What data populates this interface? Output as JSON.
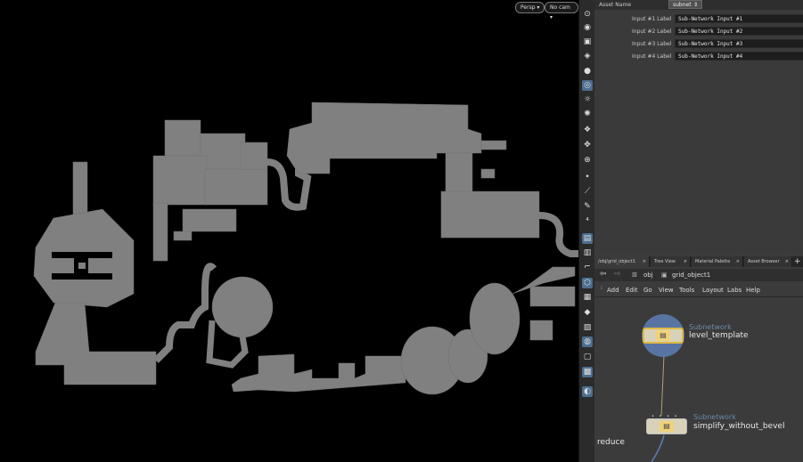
{
  "viewport": {
    "persp_label": "Persp",
    "cam_label": "No cam",
    "colors": {
      "shape": "#808080",
      "background": "#000000"
    }
  },
  "shelf": {
    "icons": [
      "view-icon",
      "eye-icon",
      "lock-icon",
      "camera-icon",
      "sphere-icon",
      "select-icon",
      "light-icon",
      "light-2-icon",
      "group-icon",
      "transform-icon",
      "handle-icon",
      "snap-icon",
      "dot-icon",
      "brush-icon",
      "pen-icon",
      "number-icon",
      "display-icon",
      "display-2-icon",
      "grid-icon",
      "wire-icon",
      "shading-icon",
      "diamond-icon",
      "box-icon",
      "paint-icon",
      "save-icon",
      "image-icon",
      "marker-icon"
    ]
  },
  "params": {
    "asset_name_label": "Asset Name",
    "asset_name_value": "subnet",
    "rows": [
      {
        "label": "Input #1 Label",
        "value": "Sub-Network Input #1"
      },
      {
        "label": "Input #2 Label",
        "value": "Sub-Network Input #2"
      },
      {
        "label": "Input #3 Label",
        "value": "Sub-Network Input #3"
      },
      {
        "label": "Input #4 Label",
        "value": "Sub-Network Input #4"
      }
    ]
  },
  "network": {
    "tabs": [
      "/obj/grid_object1",
      "Tree View",
      "Material Palette",
      "Asset Browser"
    ],
    "add_tab": "+",
    "path": {
      "level1": "obj",
      "level2": "grid_object1"
    },
    "menu": [
      "Add",
      "Edit",
      "Go",
      "View",
      "Tools",
      "Layout",
      "Labs",
      "Help"
    ],
    "nodes": [
      {
        "type": "Subnetwork",
        "name": "level_template",
        "color": "#5d7fb5"
      },
      {
        "type": "Subnetwork",
        "name": "simplify_without_bevel"
      }
    ],
    "reduce_label": "reduce"
  }
}
